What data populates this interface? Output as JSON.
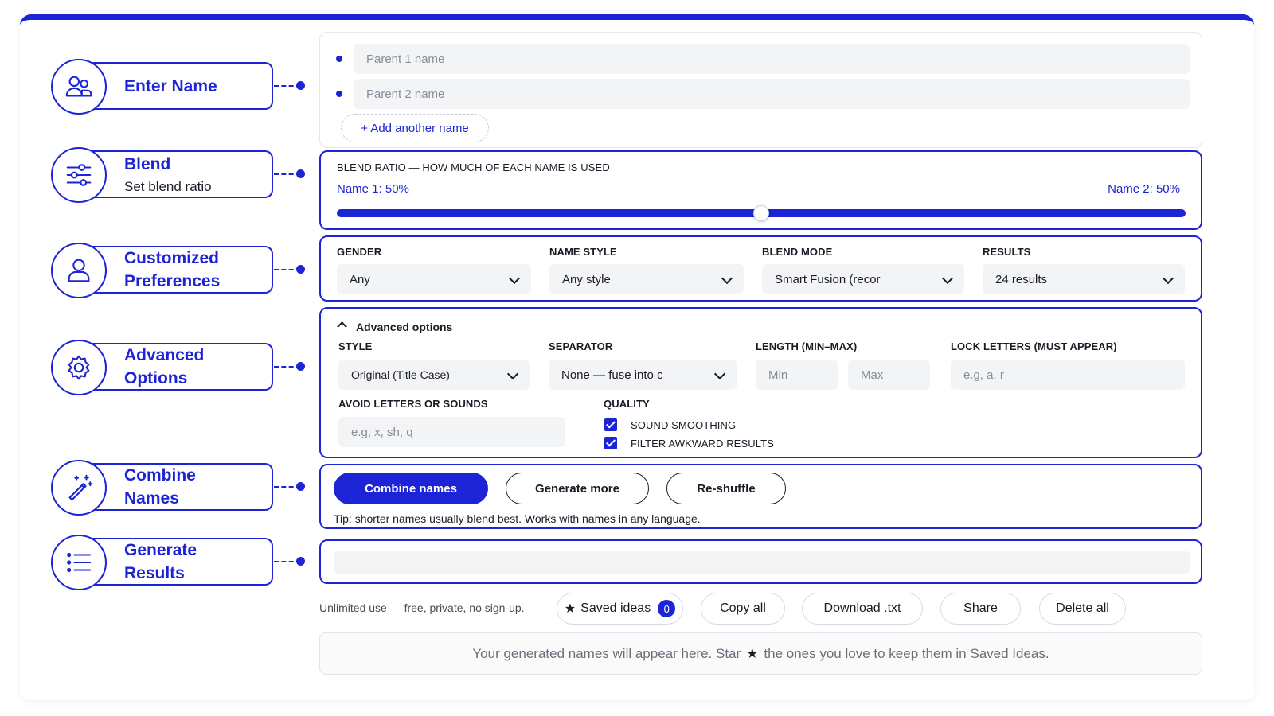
{
  "steps": [
    {
      "title": "Enter Name",
      "sub": ""
    },
    {
      "title": "Blend",
      "sub": "Set blend ratio"
    },
    {
      "title": "Customized Preferences",
      "sub": ""
    },
    {
      "title": "Advanced Options",
      "sub": ""
    },
    {
      "title": "Combine Names",
      "sub": ""
    },
    {
      "title": "Generate Results",
      "sub": ""
    }
  ],
  "names": {
    "parent1_placeholder": "Parent 1 name",
    "parent2_placeholder": "Parent 2 name",
    "add_label": "+ Add another name"
  },
  "blend": {
    "heading": "BLEND RATIO — HOW MUCH OF EACH NAME IS USED",
    "name1": "Name 1: 50%",
    "name2": "Name 2: 50%",
    "ratio": 0.5
  },
  "prefs": {
    "gender_label": "GENDER",
    "gender_value": "Any",
    "style_label": "NAME STYLE",
    "style_value": "Any style",
    "mode_label": "BLEND MODE",
    "mode_value": "Smart Fusion (recor",
    "results_label": "RESULTS",
    "results_value": "24 results"
  },
  "advanced": {
    "toggle": "Advanced options",
    "style_label": "STYLE",
    "style_value": "Original (Title Case)",
    "separator_label": "SEPARATOR",
    "separator_value": "None — fuse into c",
    "length_label": "LENGTH (MIN–MAX)",
    "min_placeholder": "Min",
    "max_placeholder": "Max",
    "lock_label": "LOCK LETTERS (MUST APPEAR)",
    "lock_placeholder": "e.g, a, r",
    "avoid_label": "AVOID LETTERS OR SOUNDS",
    "avoid_placeholder": "e.g, x, sh, q",
    "quality_label": "QUALITY",
    "smoothing": "SOUND SMOOTHING",
    "filter": "FILTER AWKWARD RESULTS"
  },
  "actions": {
    "combine": "Combine names",
    "more": "Generate more",
    "shuffle": "Re-shuffle",
    "tip": "Tip: shorter names usually blend best. Works with names in any language."
  },
  "footer": {
    "note": "Unlimited use — free, private, no sign-up.",
    "saved": "Saved ideas",
    "saved_count": "0",
    "copy": "Copy all",
    "download": "Download .txt",
    "share": "Share",
    "delete": "Delete all",
    "empty_before": "Your generated names will appear here. Star",
    "empty_star": "★",
    "empty_after": "the ones you love to keep them in Saved Ideas."
  },
  "colors": {
    "accent": "#1d24d6",
    "field_bg": "#f3f4f6"
  }
}
